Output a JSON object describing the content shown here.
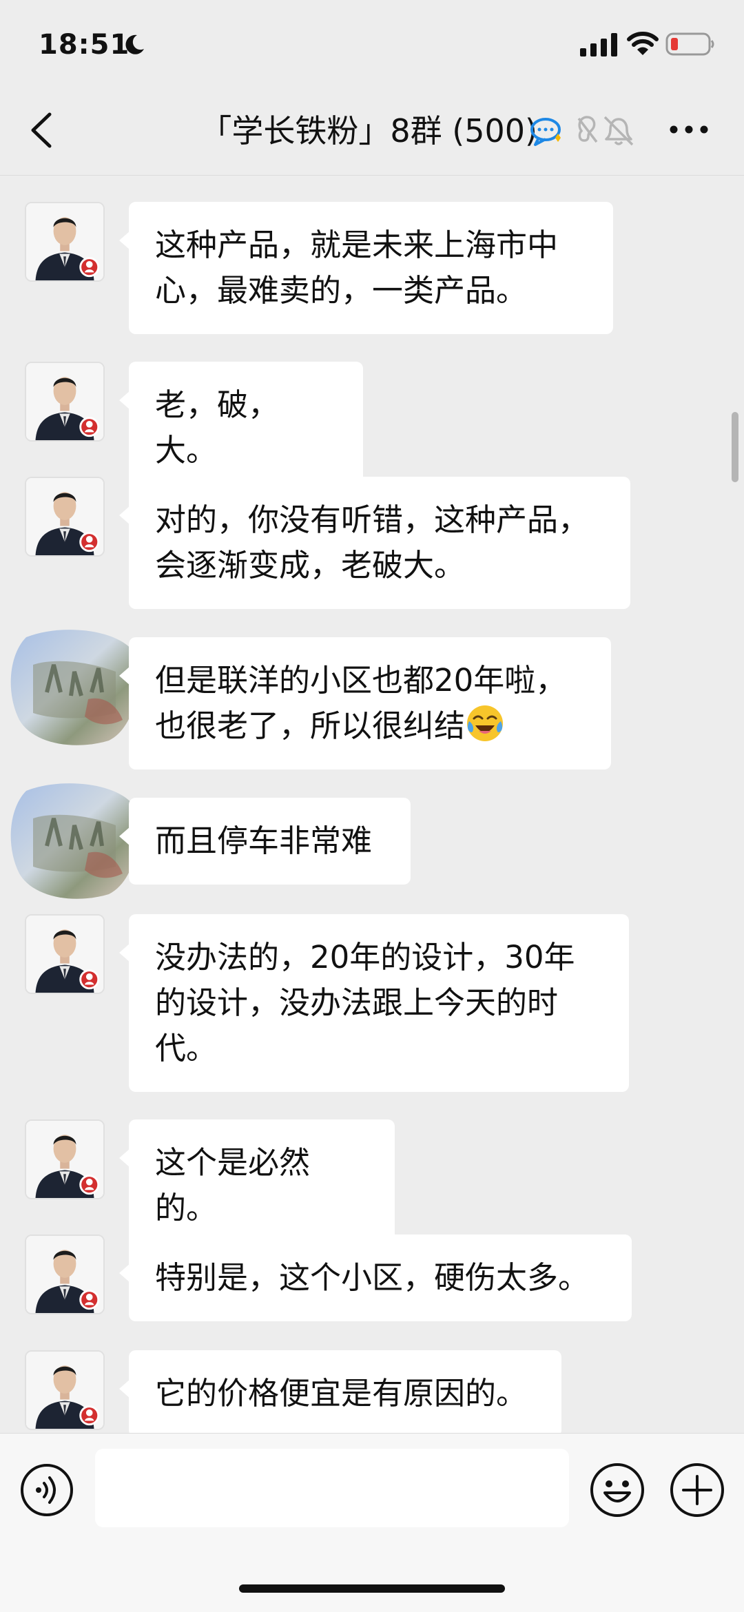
{
  "status_bar": {
    "time": "18:51"
  },
  "nav": {
    "title": "「学长铁粉」8群 (500)",
    "icons": [
      "chat-bubble-icon",
      "ear-off-icon",
      "bell-muted-icon"
    ]
  },
  "messages": [
    {
      "sender_type": "photo",
      "text": "这种产品，就是未来上海市中心，最难卖的，一类产品。"
    },
    {
      "sender_type": "photo",
      "text": "老，破，大。"
    },
    {
      "sender_type": "photo",
      "text": "对的，你没有听错，这种产品，会逐渐变成，老破大。"
    },
    {
      "sender_type": "painting",
      "text": "但是联洋的小区也都20年啦，也很老了，所以很纠结",
      "emoji": "laugh-cry-emoji-icon"
    },
    {
      "sender_type": "painting",
      "text": "而且停车非常难"
    },
    {
      "sender_type": "photo",
      "text": "没办法的，20年的设计，30年的设计，没办法跟上今天的时代。"
    },
    {
      "sender_type": "photo",
      "text": "这个是必然的。"
    },
    {
      "sender_type": "photo",
      "text": "特别是，这个小区，硬伤太多。"
    },
    {
      "sender_type": "photo",
      "text": "它的价格便宜是有原因的。"
    }
  ],
  "input": {
    "value": ""
  },
  "colors": {
    "background": "#ededed",
    "bubble": "#ffffff",
    "battery_low": "#e53935",
    "icon_blue": "#1e88e5"
  }
}
